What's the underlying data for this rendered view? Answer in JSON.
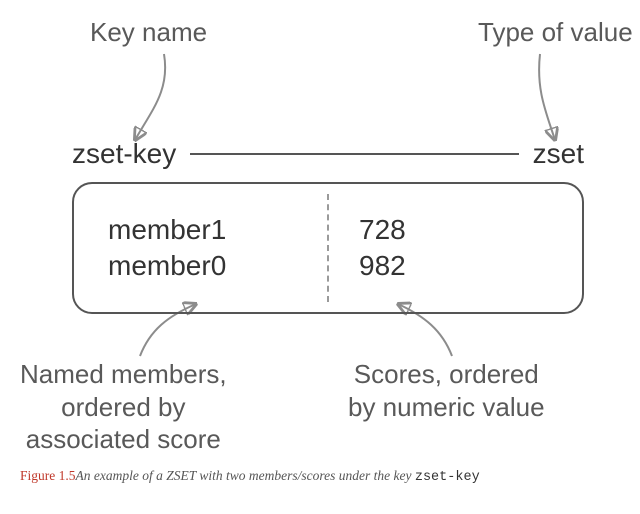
{
  "annotations": {
    "key_name": "Key name",
    "type_of_value": "Type of value",
    "named_members": "Named members,\nordered by\nassociated score",
    "scores_ordered": "Scores, ordered\nby numeric value"
  },
  "box": {
    "key": "zset-key",
    "type": "zset",
    "rows": [
      {
        "member": "member1",
        "score": "728"
      },
      {
        "member": "member0",
        "score": "982"
      }
    ]
  },
  "caption": {
    "figure": "Figure 1.5",
    "pre": "An example of a ",
    "term": "ZSET",
    "mid": " with two members/scores under the key ",
    "key": "zset-key"
  }
}
